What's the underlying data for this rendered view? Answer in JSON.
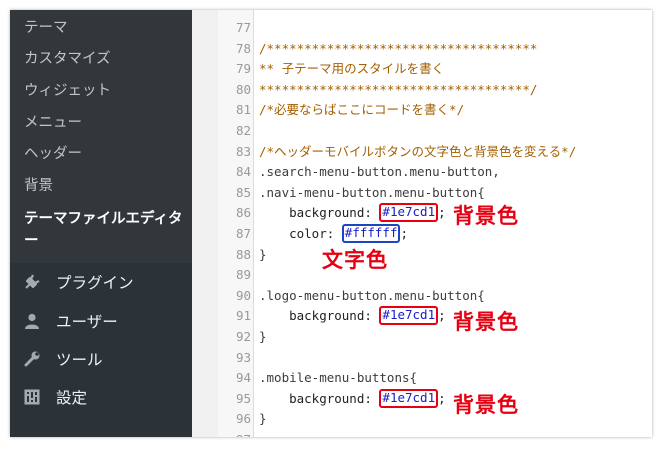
{
  "sidebar": {
    "submenu": [
      {
        "label": "テーマ"
      },
      {
        "label": "カスタマイズ"
      },
      {
        "label": "ウィジェット"
      },
      {
        "label": "メニュー"
      },
      {
        "label": "ヘッダー"
      },
      {
        "label": "背景"
      },
      {
        "label": "テーマファイルエディター",
        "current": true
      }
    ],
    "menu": [
      {
        "label": "プラグイン",
        "icon": "plugin-icon"
      },
      {
        "label": "ユーザー",
        "icon": "user-icon"
      },
      {
        "label": "ツール",
        "icon": "wrench-icon"
      },
      {
        "label": "設定",
        "icon": "settings-icon"
      }
    ]
  },
  "editor": {
    "lines": [
      {
        "n": "77",
        "parts": []
      },
      {
        "n": "78",
        "parts": [
          {
            "t": "/************************************",
            "c": "comment"
          }
        ]
      },
      {
        "n": "79",
        "parts": [
          {
            "t": "** 子テーマ用のスタイルを書く",
            "c": "comment"
          }
        ]
      },
      {
        "n": "80",
        "parts": [
          {
            "t": "************************************/",
            "c": "comment"
          }
        ]
      },
      {
        "n": "81",
        "parts": [
          {
            "t": "/*必要ならばここにコードを書く*/",
            "c": "comment"
          }
        ]
      },
      {
        "n": "82",
        "parts": []
      },
      {
        "n": "83",
        "parts": [
          {
            "t": "/*ヘッダーモバイルボタンの文字色と背景色を変える*/",
            "c": "comment"
          }
        ]
      },
      {
        "n": "84",
        "parts": [
          {
            "t": ".search-menu-button.menu-button,",
            "c": "sel"
          }
        ]
      },
      {
        "n": "85",
        "parts": [
          {
            "t": ".navi-menu-button.menu-button{",
            "c": "sel"
          }
        ]
      },
      {
        "n": "86",
        "parts": [
          {
            "t": "    background: ",
            "c": "prop"
          },
          {
            "t": "#1e7cd1",
            "c": "val",
            "box": "red"
          },
          {
            "t": ";",
            "c": "prop"
          }
        ]
      },
      {
        "n": "87",
        "parts": [
          {
            "t": "    color: ",
            "c": "prop"
          },
          {
            "t": "#ffffff",
            "c": "val",
            "box": "blue"
          },
          {
            "t": ";",
            "c": "prop"
          }
        ]
      },
      {
        "n": "88",
        "parts": [
          {
            "t": "}",
            "c": "sel"
          }
        ]
      },
      {
        "n": "89",
        "parts": []
      },
      {
        "n": "90",
        "parts": [
          {
            "t": ".logo-menu-button.menu-button{",
            "c": "sel"
          }
        ]
      },
      {
        "n": "91",
        "parts": [
          {
            "t": "    background: ",
            "c": "prop"
          },
          {
            "t": "#1e7cd1",
            "c": "val",
            "box": "red"
          },
          {
            "t": ";",
            "c": "prop"
          }
        ]
      },
      {
        "n": "92",
        "parts": [
          {
            "t": "}",
            "c": "sel"
          }
        ]
      },
      {
        "n": "93",
        "parts": []
      },
      {
        "n": "94",
        "parts": [
          {
            "t": ".mobile-menu-buttons{",
            "c": "sel"
          }
        ]
      },
      {
        "n": "95",
        "parts": [
          {
            "t": "    background: ",
            "c": "prop"
          },
          {
            "t": "#1e7cd1",
            "c": "val",
            "box": "red"
          },
          {
            "t": ";",
            "c": "prop"
          }
        ]
      },
      {
        "n": "96",
        "parts": [
          {
            "t": "}",
            "c": "sel"
          }
        ]
      },
      {
        "n": "97",
        "parts": []
      }
    ]
  },
  "annotations": [
    {
      "label": "背景色",
      "color": "#e60012",
      "line": "86"
    },
    {
      "label": "文字色",
      "color": "#e60012",
      "line": "87"
    },
    {
      "label": "背景色",
      "color": "#e60012",
      "line": "91"
    },
    {
      "label": "背景色",
      "color": "#e60012",
      "line": "95"
    }
  ],
  "colors": {
    "sidebar_bg": "#2c3338",
    "submenu_bg": "#32373c",
    "comment": "#a35f00",
    "value": "#1b20c9",
    "highlight_red": "#e60012",
    "highlight_blue": "#1c45c4"
  }
}
